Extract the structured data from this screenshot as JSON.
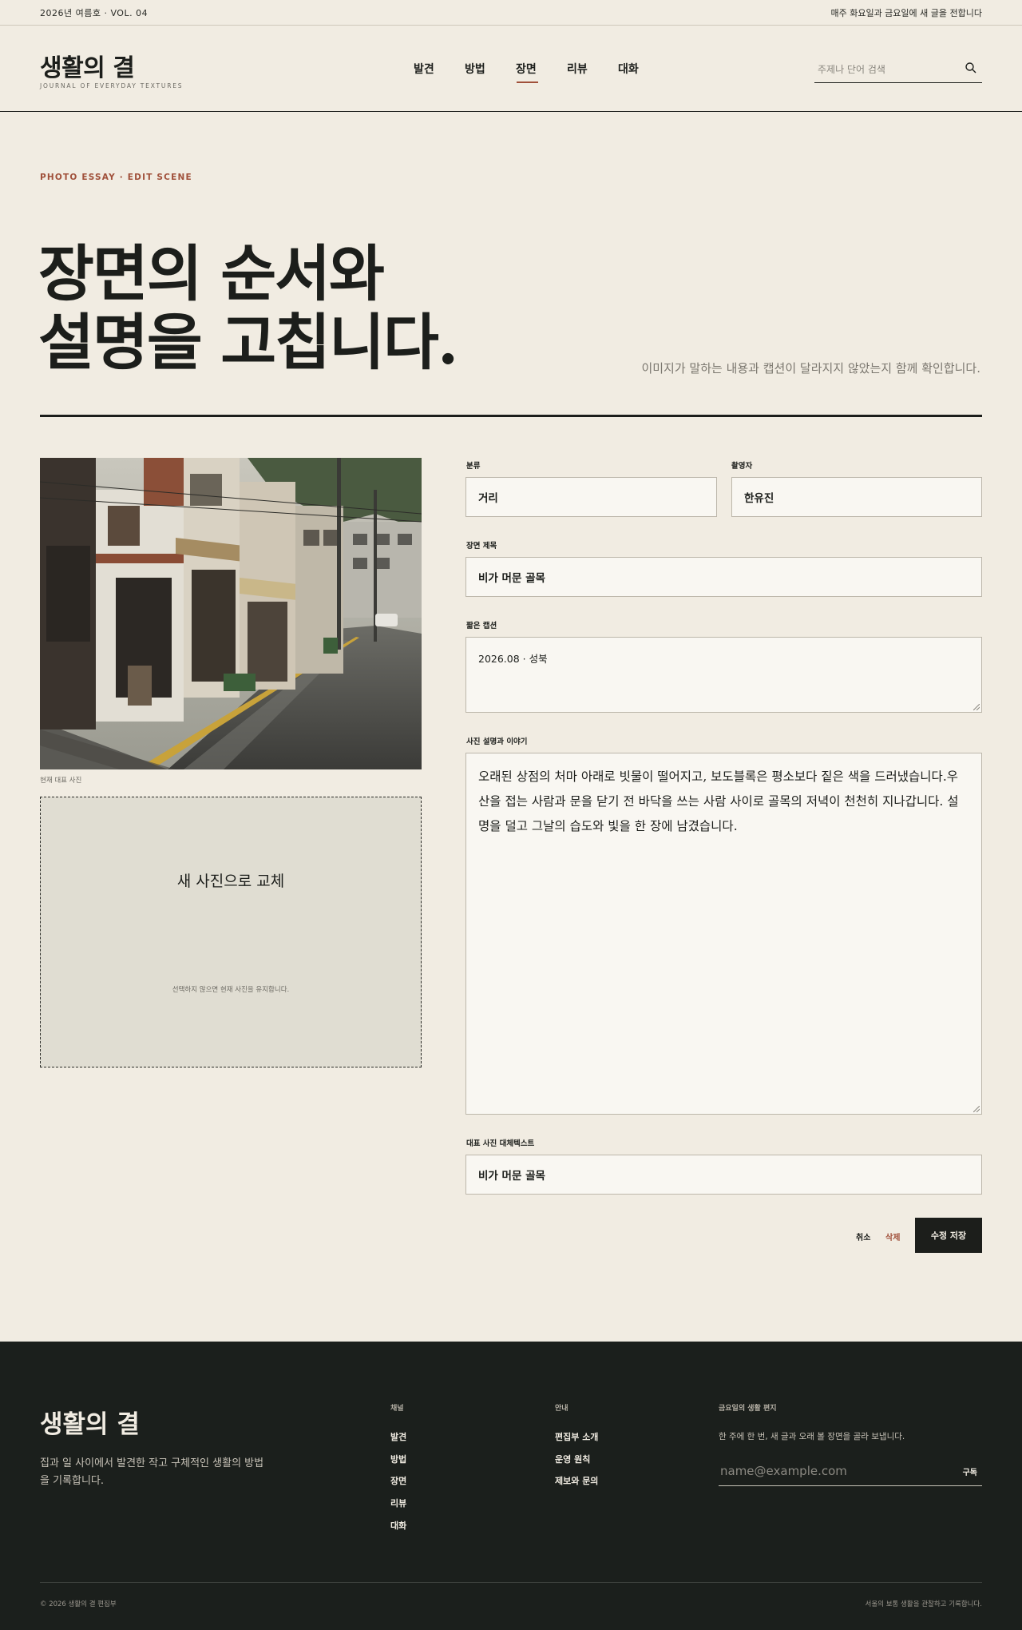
{
  "topbar": {
    "issue": "2026년 여름호 · VOL. 04",
    "notice": "매주 화요일과 금요일에 새 글을 전합니다"
  },
  "header": {
    "logo": "생활의 결",
    "logo_sub": "JOURNAL OF EVERYDAY TEXTURES",
    "nav": [
      "발견",
      "방법",
      "장면",
      "리뷰",
      "대화"
    ],
    "active_nav": "장면",
    "search_placeholder": "주제나 단어 검색"
  },
  "hero": {
    "kicker": "PHOTO ESSAY · EDIT SCENE",
    "title_line1": "장면의 순서와",
    "title_line2": "설명을 고칩니다.",
    "subtitle": "이미지가 말하는 내용과 캡션이 달라지지 않았는지 함께 확인합니다."
  },
  "photo": {
    "caption": "현재 대표 사진"
  },
  "dropzone": {
    "title": "새 사진으로 교체",
    "note": "선택하지 않으면 현재 사진을 유지합니다."
  },
  "form": {
    "category_label": "분류",
    "category_value": "거리",
    "photographer_label": "촬영자",
    "photographer_value": "한유진",
    "scene_title_label": "장면 제목",
    "scene_title_value": "비가 머문 골목",
    "short_caption_label": "짧은 캡션",
    "short_caption_value": "2026.08 · 성북",
    "story_label": "사진 설명과 이야기",
    "story_value": "오래된 상점의 처마 아래로 빗물이 떨어지고, 보도블록은 평소보다 짙은 색을 드러냈습니다.우산을 접는 사람과 문을 닫기 전 바닥을 쓰는 사람 사이로 골목의 저녁이 천천히 지나갑니다. 설명을 덜고 그날의 습도와 빛을 한 장에 남겼습니다.",
    "alt_label": "대표 사진 대체텍스트",
    "alt_value": "비가 머문 골목"
  },
  "actions": {
    "cancel": "취소",
    "delete": "삭제",
    "save": "수정 저장"
  },
  "footer": {
    "logo": "생활의 결",
    "desc": "집과 일 사이에서 발견한 작고 구체적인 생활의 방법을 기록합니다.",
    "channel_title": "채널",
    "channel_links": [
      "발견",
      "방법",
      "장면",
      "리뷰",
      "대화"
    ],
    "info_title": "안내",
    "info_links": [
      "편집부 소개",
      "운영 원칙",
      "제보와 문의"
    ],
    "newsletter_title": "금요일의 생활 편지",
    "newsletter_desc": "한 주에 한 번, 새 글과 오래 볼 장면을 골라 보냅니다.",
    "email_placeholder": "name@example.com",
    "subscribe": "구독",
    "copyright": "© 2026 생활의 결 편집부",
    "right_note": "서울의 보통 생활을 관찰하고 기록합니다."
  },
  "colors": {
    "background": "#f1ece2",
    "ink": "#1c1e1b",
    "accent": "#a0503a",
    "footer_bg": "#1b1f1c"
  },
  "icons": {
    "search": "search-icon"
  }
}
